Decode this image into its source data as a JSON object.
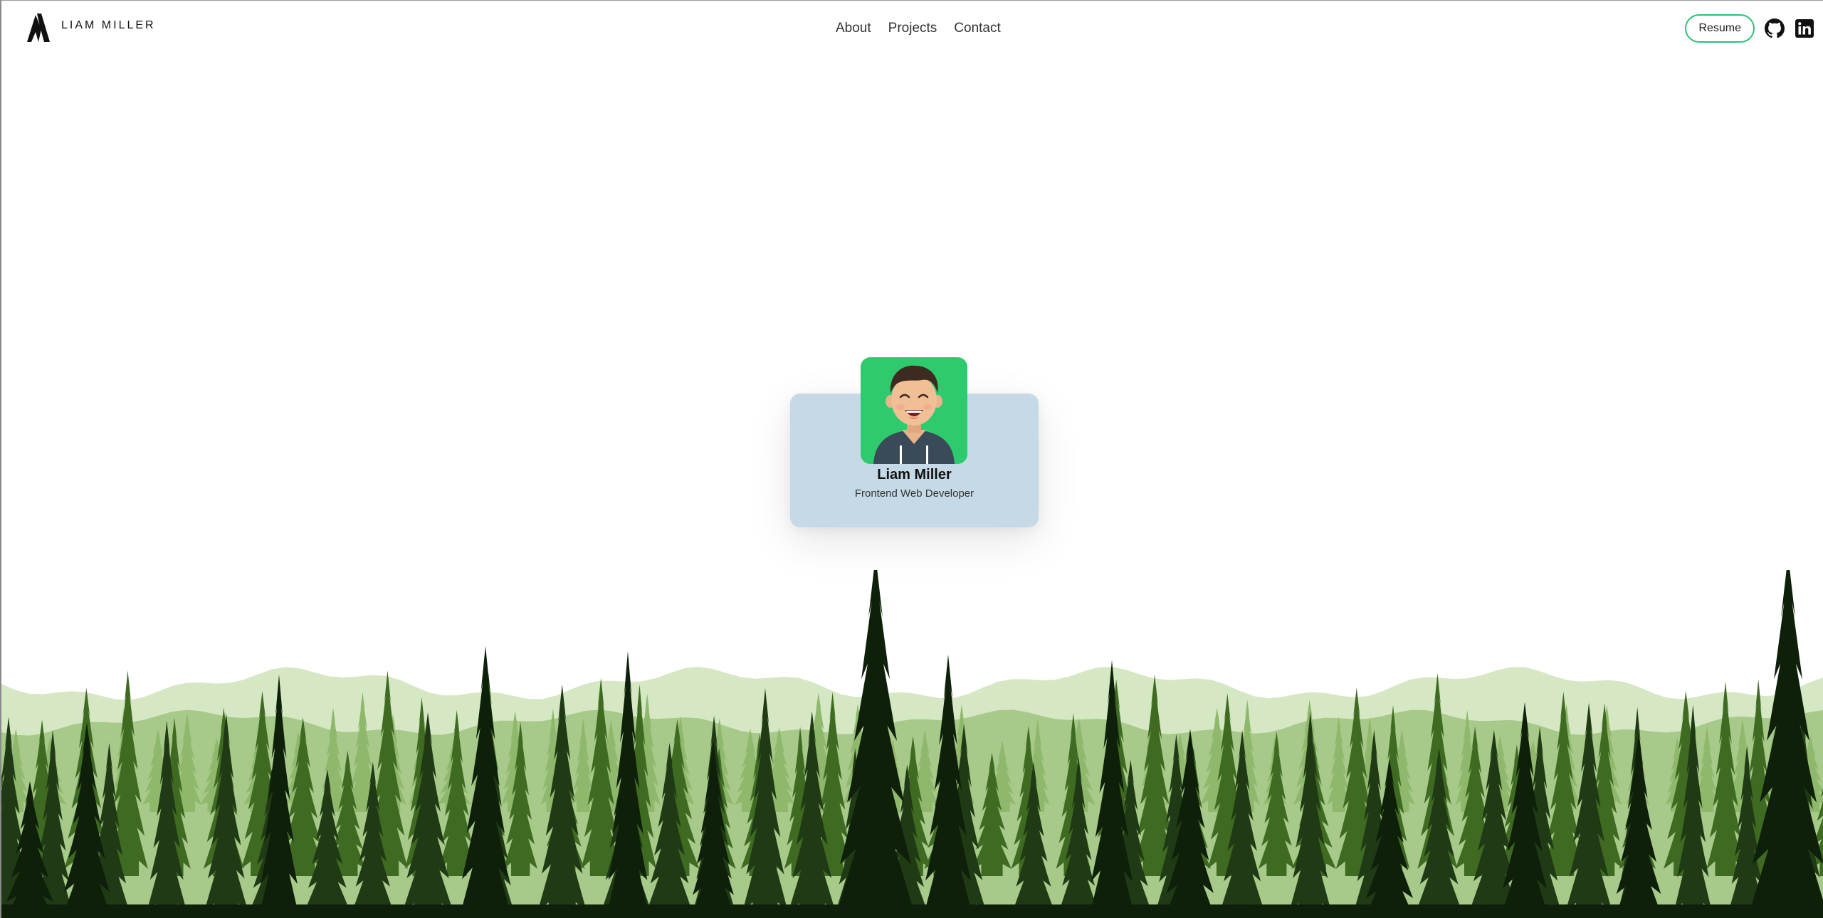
{
  "header": {
    "logo_text": "LIAM MILLER",
    "nav": [
      {
        "label": "About"
      },
      {
        "label": "Projects"
      },
      {
        "label": "Contact"
      }
    ],
    "resume_label": "Resume",
    "social_icons": [
      "github-icon",
      "linkedin-icon"
    ]
  },
  "profile": {
    "name": "Liam Miller",
    "role": "Frontend Web Developer",
    "avatar_icon": "avatar-illustration"
  },
  "colors": {
    "accent": "#2bbf7b",
    "card_bg": "#c5dae6",
    "avatar_bg": "#2fc96e",
    "forest_dark": "#0e1f0a",
    "forest_mid": "#3f6a22",
    "forest_light": "#a7c98a",
    "forest_pale": "#d5e8c3"
  }
}
